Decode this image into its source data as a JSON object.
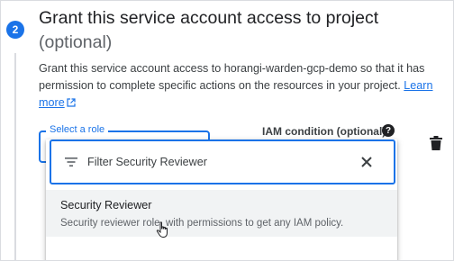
{
  "step": {
    "number": "2",
    "title": "Grant this service account access to project",
    "title_optional": "(optional)"
  },
  "description": {
    "text": "Grant this service account access to horangi-warden-gcp-demo so that it has permission to complete specific actions on the resources in your project.",
    "link_text": "Learn more"
  },
  "role_select": {
    "label": "Select a role"
  },
  "iam_condition": {
    "label": "IAM condition (optional)",
    "help_glyph": "?"
  },
  "dropdown": {
    "filter_value": "Filter Security Reviewer",
    "options": [
      {
        "title": "Security Reviewer",
        "description": "Security reviewer role, with permissions to get any IAM policy."
      }
    ]
  },
  "colors": {
    "accent": "#1a73e8",
    "text": "#202124",
    "secondary_text": "#5f6368"
  },
  "icons": [
    "filter-icon",
    "close-icon",
    "delete-icon",
    "help-icon",
    "external-link-icon",
    "hand-pointer-icon"
  ]
}
